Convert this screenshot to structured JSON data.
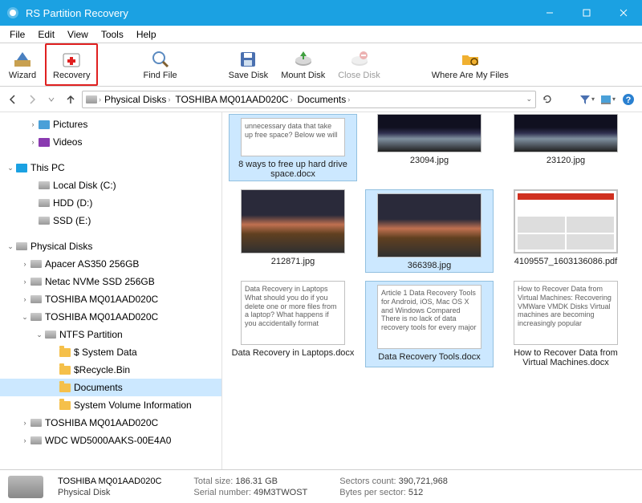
{
  "app": {
    "title": "RS Partition Recovery"
  },
  "menu": [
    "File",
    "Edit",
    "View",
    "Tools",
    "Help"
  ],
  "toolbar": [
    {
      "id": "wizard",
      "label": "Wizard",
      "icon": "wizard-icon"
    },
    {
      "id": "recovery",
      "label": "Recovery",
      "icon": "recovery-icon",
      "selected": true
    },
    {
      "id": "findfile",
      "label": "Find File",
      "icon": "search-icon"
    },
    {
      "id": "savedisk",
      "label": "Save Disk",
      "icon": "save-disk-icon"
    },
    {
      "id": "mountdisk",
      "label": "Mount Disk",
      "icon": "mount-disk-icon"
    },
    {
      "id": "closedisk",
      "label": "Close Disk",
      "icon": "close-disk-icon",
      "disabled": true
    },
    {
      "id": "whereare",
      "label": "Where Are My Files",
      "icon": "folder-search-icon"
    }
  ],
  "breadcrumb": [
    "Physical Disks",
    "TOSHIBA MQ01AAD020C",
    "Documents"
  ],
  "tree": {
    "quick": [
      {
        "label": "Pictures",
        "icon": "pictures"
      },
      {
        "label": "Videos",
        "icon": "videos"
      }
    ],
    "thispc": {
      "label": "This PC",
      "children": [
        {
          "label": "Local Disk (C:)",
          "icon": "disk"
        },
        {
          "label": "HDD (D:)",
          "icon": "disk"
        },
        {
          "label": "SSD (E:)",
          "icon": "disk"
        }
      ]
    },
    "physical": {
      "label": "Physical Disks",
      "children": [
        {
          "label": "Apacer AS350 256GB",
          "icon": "disk"
        },
        {
          "label": "Netac NVMe SSD 256GB",
          "icon": "disk"
        },
        {
          "label": "TOSHIBA MQ01AAD020C",
          "icon": "disk"
        },
        {
          "label": "TOSHIBA MQ01AAD020C",
          "icon": "disk",
          "expanded": true,
          "children": [
            {
              "label": "NTFS Partition",
              "icon": "disk",
              "expanded": true,
              "children": [
                {
                  "label": "$ System Data",
                  "icon": "folder"
                },
                {
                  "label": "$Recycle.Bin",
                  "icon": "folder"
                },
                {
                  "label": "Documents",
                  "icon": "folder",
                  "selected": true
                },
                {
                  "label": "System Volume Information",
                  "icon": "folder"
                }
              ]
            }
          ]
        },
        {
          "label": "TOSHIBA MQ01AAD020C",
          "icon": "disk"
        },
        {
          "label": "WDC WD5000AAKS-00E4A0",
          "icon": "disk"
        }
      ]
    }
  },
  "files": [
    {
      "name": "8 ways to free up hard drive space.docx",
      "type": "doc",
      "preview": "unnecessary data that take up free space? Below we will",
      "selected": true,
      "half": true
    },
    {
      "name": "23094.jpg",
      "type": "img-dark",
      "half": true
    },
    {
      "name": "23120.jpg",
      "type": "img-dark",
      "half": true
    },
    {
      "name": "212871.jpg",
      "type": "img-mount"
    },
    {
      "name": "366398.jpg",
      "type": "img-mount2",
      "selected": true
    },
    {
      "name": "4109557_1603136086.pdf",
      "type": "pdf"
    },
    {
      "name": "Data Recovery in Laptops.docx",
      "type": "doc",
      "preview": "Data Recovery in Laptops\nWhat should you do if you delete one or more files from a laptop? What happens if you accidentally format"
    },
    {
      "name": "Data Recovery Tools.docx",
      "type": "doc",
      "preview": "Article 1\nData Recovery Tools for Android, iOS, Mac OS X and Windows Compared\nThere is no lack of data recovery tools for every major",
      "selected": true
    },
    {
      "name": "How to Recover Data from Virtual Machines.docx",
      "type": "doc",
      "preview": "How to Recover Data from Virtual Machines: Recovering VMWare VMDK Disks\nVirtual machines are becoming increasingly popular"
    }
  ],
  "status": {
    "name": "TOSHIBA MQ01AAD020C",
    "type": "Physical Disk",
    "total_size_label": "Total size:",
    "total_size": "186.31 GB",
    "serial_label": "Serial number:",
    "serial": "49M3TWOST",
    "sectors_label": "Sectors count:",
    "sectors": "390,721,968",
    "bps_label": "Bytes per sector:",
    "bps": "512"
  }
}
